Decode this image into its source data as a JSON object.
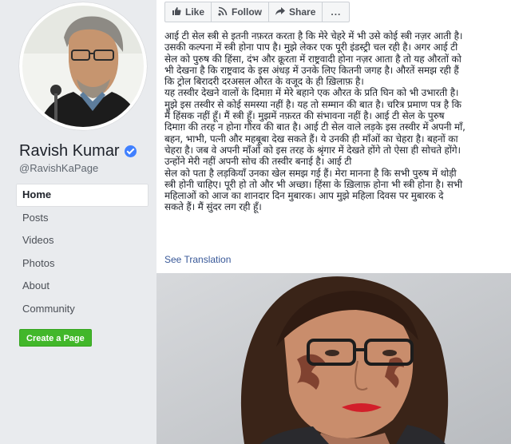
{
  "profile": {
    "name": "Ravish Kumar",
    "handle": "@RavishKaPage",
    "verified": true
  },
  "nav": {
    "items": [
      {
        "label": "Home",
        "active": true
      },
      {
        "label": "Posts",
        "active": false
      },
      {
        "label": "Videos",
        "active": false
      },
      {
        "label": "Photos",
        "active": false
      },
      {
        "label": "About",
        "active": false
      },
      {
        "label": "Community",
        "active": false
      }
    ],
    "create_page_label": "Create a Page"
  },
  "actions": {
    "like_label": "Like",
    "follow_label": "Follow",
    "share_label": "Share",
    "more_label": "..."
  },
  "post": {
    "lines": [
      "आई टी सेल स्त्री से इतनी नफ़रत करता है कि मेरे चेहरे में भी उसे कोई स्त्री नज़र आती है।",
      "उसकी कल्पना में स्त्री होना पाप है। मुझे लेकर एक पूरी इंडस्ट्री चल रही है। अगर आई टी",
      "सेल को पुरुष की हिंसा, दंभ और क्रूरता में राष्ट्रवादी होना नज़र आता है तो यह औरतों को",
      "भी देखना है कि राष्ट्रवाद के इस अंधड़ में उनके लिए कितनी जगह है। औरतें समझ रही हैं",
      "कि ट्रोल बिरादरी दरअसल औरत के वजूद के ही ख़िलाफ़ है।",
      "यह तस्वीर देखने वालों के दिमाग़ में मेरे बहाने एक औरत के प्रति घिन को भी उभारती है।",
      "म‌ुझे इस तस्वीर से कोई समस्या नहीं है। यह तो सम्मान की बात है। चरित्र प्रमाण पत्र है कि",
      "मैं हिंसक नहीं हूँ। मैं स्त्री हूँ। मुझमें नफ़रत की संभावना नहीं है। आई टी सेल के पुरुष",
      "दिमाग़ की तरह न होना गौरव की बात है। आई टी सेल वाले लड़के इस तस्वीर में अपनी माँ,",
      "बहन, भाभी, पत्नी और महबूबा देख सकते हैं। ये उनकी ही माँओं का चेहरा है। बहनों का",
      "चेहरा है। जब वे अपनी माँओं को इस तरह के श्रृंगार में देखते होंगे तो ऐसा ही सोचते होंगे।",
      "उन्होंने मेरी नहीं अपनी सोच की तस्वीर बनाई है। आई टी",
      "सेल को पता है लड़कियाँ उनका खेल समझ गई हैं। मेरा मानना है कि सभी पुरुष में थोड़ी",
      "स्त्री होनी चाहिए। पूरी हो तो और भी अच्छा। हिंसा के ख़िलाफ़ होना भी स्त्री होना है। सभी",
      "महिलाओं को आज का शानदार दिन मुबारक। आप मुझे महिला दिवस पर मुबारक दे",
      "सकते हैं। मैं सुंदर लग रही हूँ।"
    ],
    "see_translation": "See Translation"
  },
  "colors": {
    "link": "#385898",
    "verified": "#4080ff",
    "create_page": "#42b72a",
    "page_bg": "#e9ebee"
  }
}
